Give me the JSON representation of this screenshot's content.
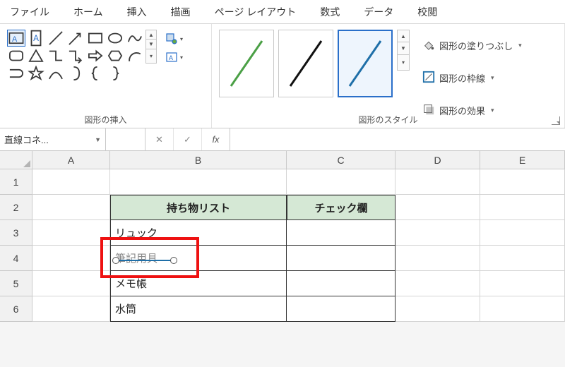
{
  "tabs": {
    "file": "ファイル",
    "home": "ホーム",
    "insert": "挿入",
    "draw": "描画",
    "layout": "ページ レイアウト",
    "formulas": "数式",
    "data": "データ",
    "review": "校閲"
  },
  "ribbon": {
    "group_shapes_label": "図形の挿入",
    "group_styles_label": "図形のスタイル",
    "fill_label": "図形の塗りつぶし",
    "outline_label": "図形の枠線",
    "effects_label": "図形の効果",
    "style_colors": {
      "a": "#4ba046",
      "b": "#111111",
      "c": "#1f6fa8"
    }
  },
  "namebar": {
    "name": "直線コネ...",
    "cancel": "✕",
    "confirm": "✓",
    "fx": "fx"
  },
  "columns": {
    "A": "A",
    "B": "B",
    "C": "C",
    "D": "D",
    "E": "E"
  },
  "rows": {
    "r1": "1",
    "r2": "2",
    "r3": "3",
    "r4": "4",
    "r5": "5",
    "r6": "6"
  },
  "table": {
    "header_b": "持ち物リスト",
    "header_c": "チェック欄",
    "items": [
      "リュック",
      "筆記用具",
      "メモ帳",
      "水筒"
    ]
  }
}
